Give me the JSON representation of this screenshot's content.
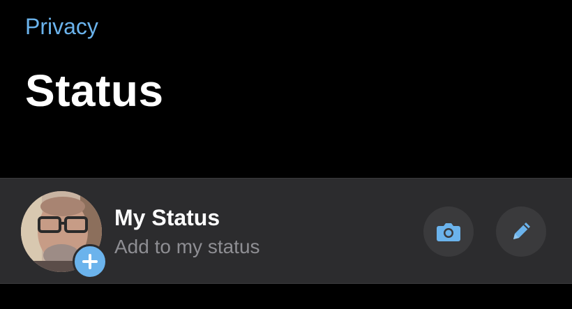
{
  "nav": {
    "back_label": "Privacy"
  },
  "page": {
    "title": "Status"
  },
  "my_status": {
    "name": "My Status",
    "subtitle": "Add to my status"
  },
  "colors": {
    "accent": "#6bb3ec",
    "background": "#000000",
    "row_background": "#2c2c2e",
    "subtitle_text": "#8e8e93"
  },
  "icons": {
    "add": "plus-icon",
    "camera": "camera-icon",
    "pencil": "pencil-icon"
  }
}
